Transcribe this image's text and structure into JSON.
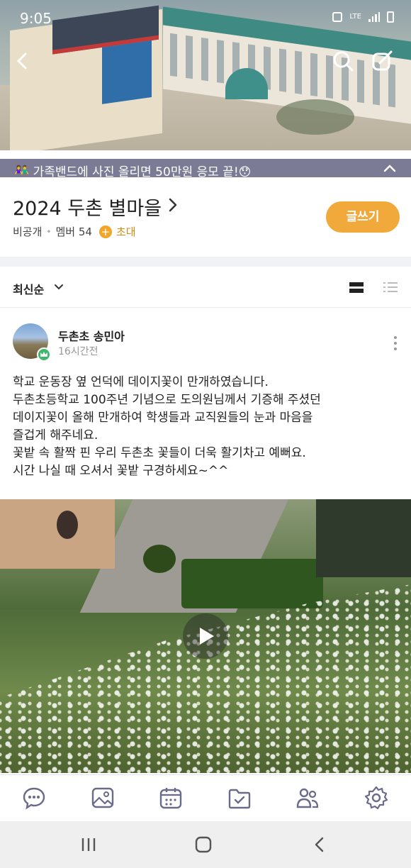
{
  "status_bar": {
    "time": "9:05",
    "network": "LTE"
  },
  "notice": {
    "text": "👫 가족밴드에 사진 올리면 50만원 응모 끝!😯"
  },
  "band": {
    "title": "2024 두촌 별마을",
    "privacy": "비공개",
    "members_label": "멤버 54",
    "invite_label": "초대",
    "write_label": "글쓰기"
  },
  "sort": {
    "label": "최신순"
  },
  "post": {
    "author": "두촌초 송민아",
    "time_ago": "16시간전",
    "body_lines": [
      "학교 운동장 옆 언덕에 데이지꽃이 만개하였습니다.",
      "두촌초등학교 100주년 기념으로 도의원님께서 기증해 주셨던",
      "데이지꽃이 올해 만개하여  학생들과 교직원들의 눈과 마음을",
      "즐겁게 해주네요.",
      "꽃밭 속 활짝 핀 우리 두촌초 꽃들이 더욱 활기차고 예뻐요.",
      "시간 나실 때 오셔서 꽃밭 구경하세요~^^"
    ]
  },
  "colors": {
    "accent": "#f2a93b",
    "invite": "#d68a14",
    "notice_bg": "#70708c",
    "badge_green": "#3fb86b"
  },
  "icons": {
    "tabs": [
      "chat-icon",
      "photo-icon",
      "calendar-icon",
      "folder-icon",
      "members-icon",
      "settings-icon"
    ]
  }
}
